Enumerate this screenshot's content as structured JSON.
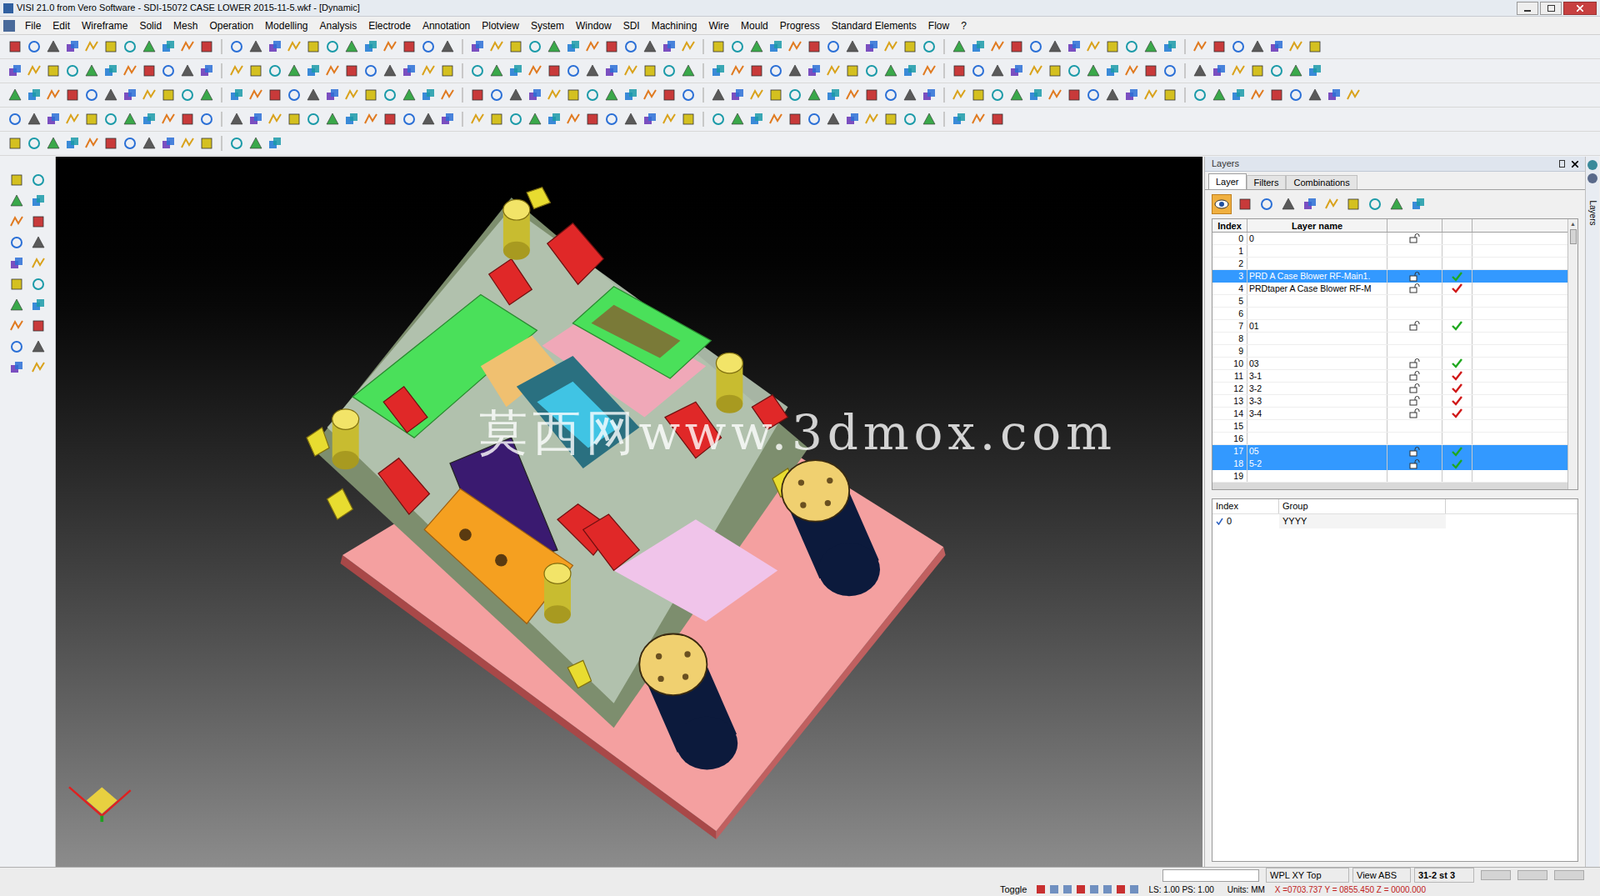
{
  "window": {
    "title": "VISI 21.0 from Vero Software - SDI-15072 CASE LOWER 2015-11-5.wkf - [Dynamic]"
  },
  "menu": [
    "File",
    "Edit",
    "Wireframe",
    "Solid",
    "Mesh",
    "Operation",
    "Modelling",
    "Analysis",
    "Electrode",
    "Annotation",
    "Plotview",
    "System",
    "Window",
    "SDI",
    "Machining",
    "Wire",
    "Mould",
    "Progress",
    "Standard Elements",
    "Flow",
    "?"
  ],
  "viewport": {
    "watermark": "莫西网www.3dmox.com"
  },
  "layers_panel": {
    "title": "Layers",
    "tabs": [
      {
        "label": "Layer",
        "selected": true
      },
      {
        "label": "Filters",
        "selected": false
      },
      {
        "label": "Combinations",
        "selected": false
      }
    ],
    "columns": [
      "Index",
      "Layer name"
    ],
    "rows": [
      {
        "index": "0",
        "name": "0",
        "lock": true,
        "check": false,
        "selected": false
      },
      {
        "index": "1",
        "name": "",
        "lock": false,
        "check": false,
        "selected": false
      },
      {
        "index": "2",
        "name": "",
        "lock": false,
        "check": false,
        "selected": false
      },
      {
        "index": "3",
        "name": "PRD A Case Blower RF-Main1.",
        "lock": true,
        "check": true,
        "color": "#1fa81f",
        "selected": true
      },
      {
        "index": "4",
        "name": "PRDtaper  A Case Blower RF-M",
        "lock": true,
        "check": true,
        "color": "#d01818",
        "selected": false
      },
      {
        "index": "5",
        "name": "",
        "lock": false,
        "check": false,
        "selected": false
      },
      {
        "index": "6",
        "name": "",
        "lock": false,
        "check": false,
        "selected": false
      },
      {
        "index": "7",
        "name": "01",
        "lock": true,
        "check": true,
        "color": "#1fa81f",
        "selected": false
      },
      {
        "index": "8",
        "name": "",
        "lock": false,
        "check": false,
        "selected": false
      },
      {
        "index": "9",
        "name": "",
        "lock": false,
        "check": false,
        "selected": false
      },
      {
        "index": "10",
        "name": "03",
        "lock": true,
        "check": true,
        "color": "#1fa81f",
        "selected": false
      },
      {
        "index": "11",
        "name": "3-1",
        "lock": true,
        "check": true,
        "color": "#d01818",
        "selected": false
      },
      {
        "index": "12",
        "name": "3-2",
        "lock": true,
        "check": true,
        "color": "#d01818",
        "selected": false
      },
      {
        "index": "13",
        "name": "3-3",
        "lock": true,
        "check": true,
        "color": "#d01818",
        "selected": false
      },
      {
        "index": "14",
        "name": "3-4",
        "lock": true,
        "check": true,
        "color": "#d01818",
        "selected": false
      },
      {
        "index": "15",
        "name": "",
        "lock": false,
        "check": false,
        "selected": false
      },
      {
        "index": "16",
        "name": "",
        "lock": false,
        "check": false,
        "selected": false
      },
      {
        "index": "17",
        "name": "05",
        "lock": true,
        "check": true,
        "color": "#1fa81f",
        "selected": true
      },
      {
        "index": "18",
        "name": "5-2",
        "lock": true,
        "check": true,
        "color": "#1fa81f",
        "selected": true
      },
      {
        "index": "19",
        "name": "",
        "lock": false,
        "check": false,
        "selected": false
      }
    ],
    "groups": {
      "columns": [
        "Index",
        "Group"
      ],
      "rows": [
        {
          "index": "0",
          "group": "YYYY",
          "checked": true
        }
      ]
    }
  },
  "side_tab": "Layers",
  "status_bar": {
    "wpl": "WPL XY Top",
    "view": "View ABS",
    "layer": "31-2 st 3",
    "toggle": "Toggle",
    "scale": "LS: 1.00 PS: 1.00",
    "units": "Units: MM",
    "coords": "X =0703.737 Y = 0855.450 Z = 0000.000"
  }
}
